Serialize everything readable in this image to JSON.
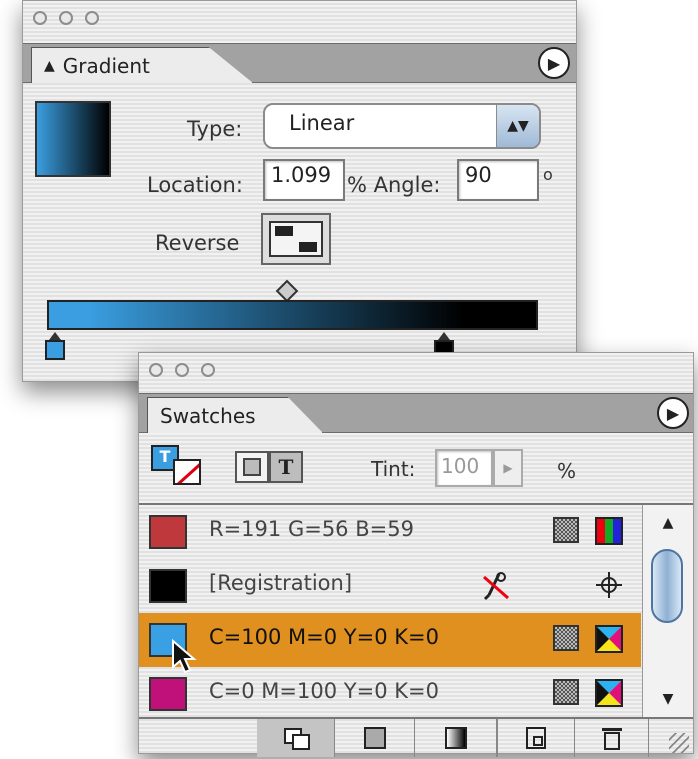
{
  "gradient_panel": {
    "tab_label": "Gradient",
    "tab_icon": "up-down-arrows-icon",
    "type_label": "Type:",
    "type_value": "Linear",
    "location_label": "Location:",
    "location_value": "1.099",
    "percent_angle_label": "% Angle:",
    "angle_value": "90",
    "degree_symbol": "o",
    "reverse_label": "Reverse",
    "gradient_colors": {
      "start": "#3a9ee0",
      "end": "#000000"
    }
  },
  "swatches_panel": {
    "tab_label": "Swatches",
    "tint_label": "Tint:",
    "tint_value": "100",
    "tint_unit": "%",
    "text_toggle_glyph": "T",
    "rows": [
      {
        "name": "R=191 G=56 B=59",
        "color": "#bf383b",
        "mode_icon": "process-color-icon",
        "type_icon": "rgb-icon"
      },
      {
        "name": "[Registration]",
        "color": "#000000",
        "mode_icon": "no-edit-icon",
        "type_icon": "registration-icon"
      },
      {
        "name": "C=100 M=0 Y=0 K=0",
        "color": "#3aa0e4",
        "mode_icon": "process-color-icon",
        "type_icon": "cmyk-icon",
        "selected": true
      },
      {
        "name": "C=0 M=100 Y=0 K=0",
        "color": "#c0117a",
        "mode_icon": "process-color-icon",
        "type_icon": "cmyk-icon"
      }
    ],
    "selected_color": "#e0901f"
  }
}
